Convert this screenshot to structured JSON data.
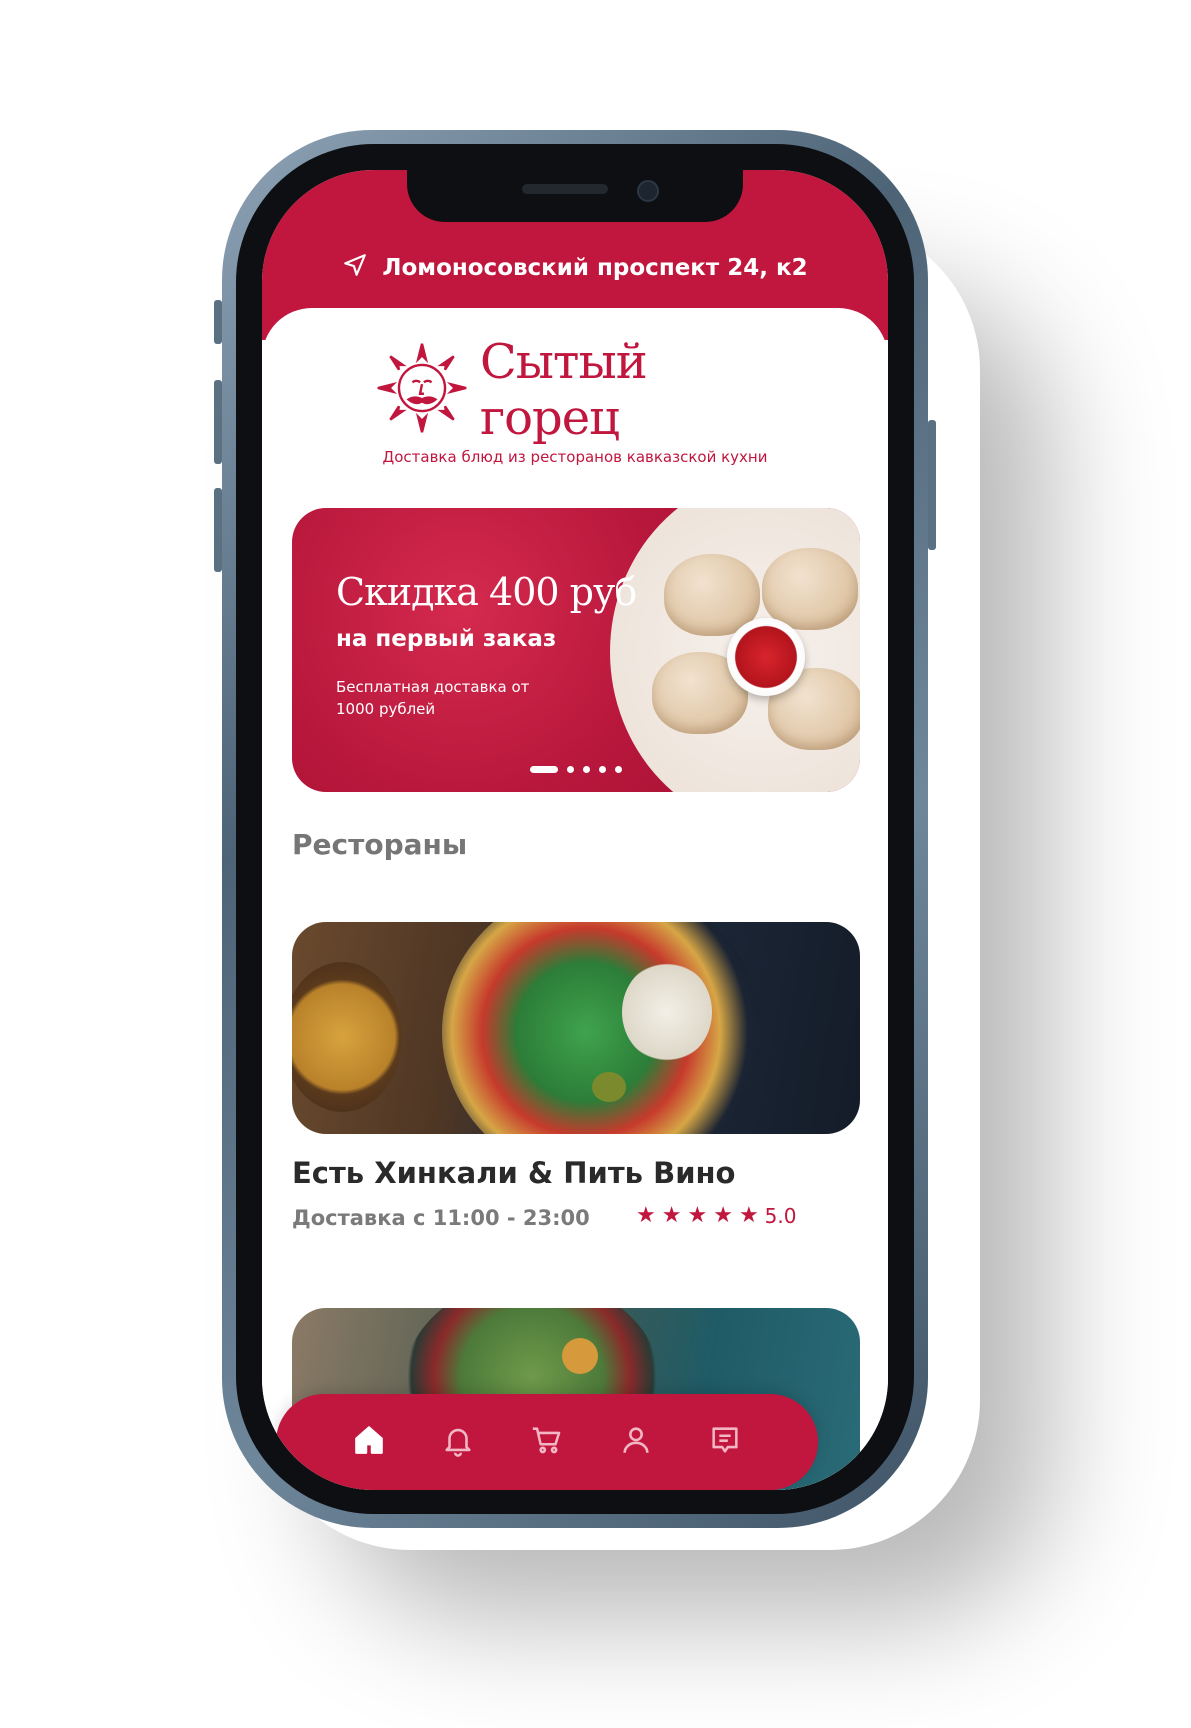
{
  "header": {
    "location_icon": "navigation-arrow-icon",
    "address": "Ломоносовский проспект  24, к2"
  },
  "brand": {
    "name": "Сытый горец",
    "tagline": "Доставка блюд из ресторанов кавказской кухни",
    "logo_icon": "sun-face-emblem-icon"
  },
  "promo": {
    "title": "Скидка 400 руб",
    "subtitle": "на первый заказ",
    "note": "Бесплатная доставка от 1000 рублей",
    "slides": 5,
    "active_slide": 1
  },
  "restaurants": {
    "section_title": "Рестораны",
    "items": [
      {
        "name": "Есть Хинкали & Пить Вино",
        "hours": "Доставка с 11:00 - 23:00",
        "rating": "5.0",
        "stars": 5
      }
    ]
  },
  "nav": {
    "items": [
      {
        "icon": "home-icon",
        "active": true
      },
      {
        "icon": "bell-icon",
        "active": false
      },
      {
        "icon": "cart-icon",
        "active": false
      },
      {
        "icon": "user-icon",
        "active": false
      },
      {
        "icon": "chat-icon",
        "active": false
      }
    ]
  },
  "colors": {
    "brand": "#c1163d",
    "text_dark": "#2a2a2a",
    "text_muted": "#767676"
  }
}
